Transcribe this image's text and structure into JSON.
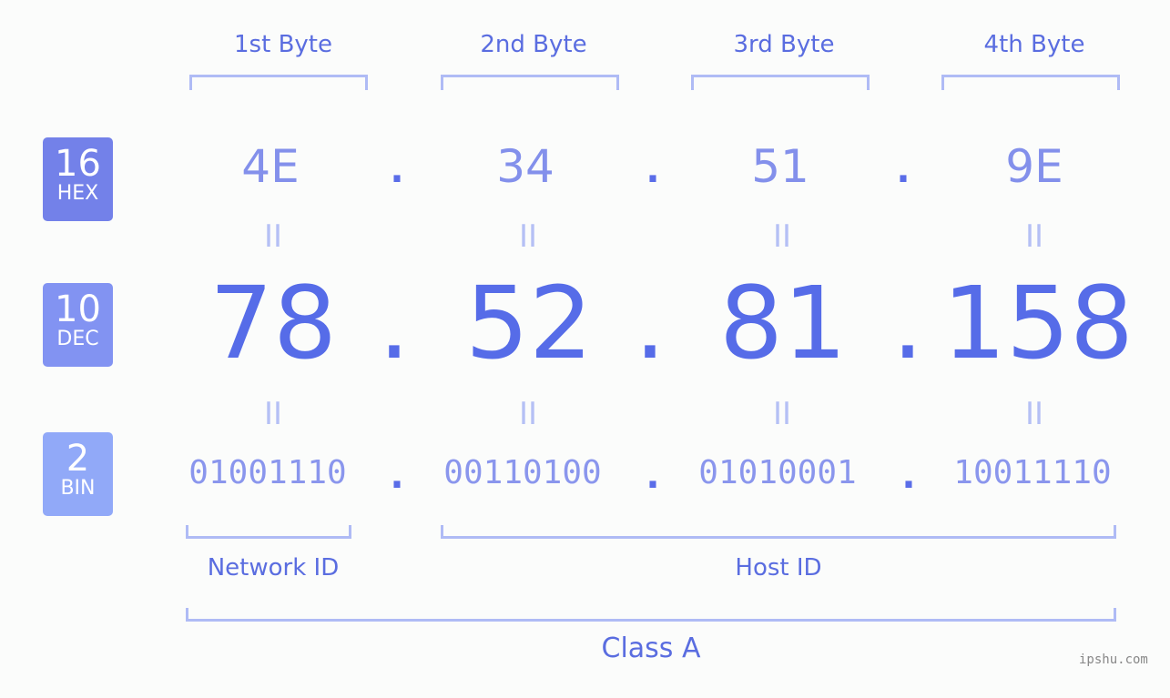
{
  "bytes": {
    "headers": [
      "1st Byte",
      "2nd Byte",
      "3rd Byte",
      "4th Byte"
    ]
  },
  "bases": {
    "hex": {
      "number": "16",
      "label": "HEX",
      "color": "#7381e9"
    },
    "dec": {
      "number": "10",
      "label": "DEC",
      "color": "#8293f2"
    },
    "bin": {
      "number": "2",
      "label": "BIN",
      "color": "#91a9f8"
    }
  },
  "ip": {
    "hex": [
      "4E",
      "34",
      "51",
      "9E"
    ],
    "dec": [
      "78",
      "52",
      "81",
      "158"
    ],
    "bin": [
      "01001110",
      "00110100",
      "01010001",
      "10011110"
    ],
    "separator": ".",
    "equals": "II"
  },
  "labels": {
    "network_id": "Network ID",
    "host_id": "Host ID",
    "class": "Class A"
  },
  "watermark": "ipshu.com"
}
